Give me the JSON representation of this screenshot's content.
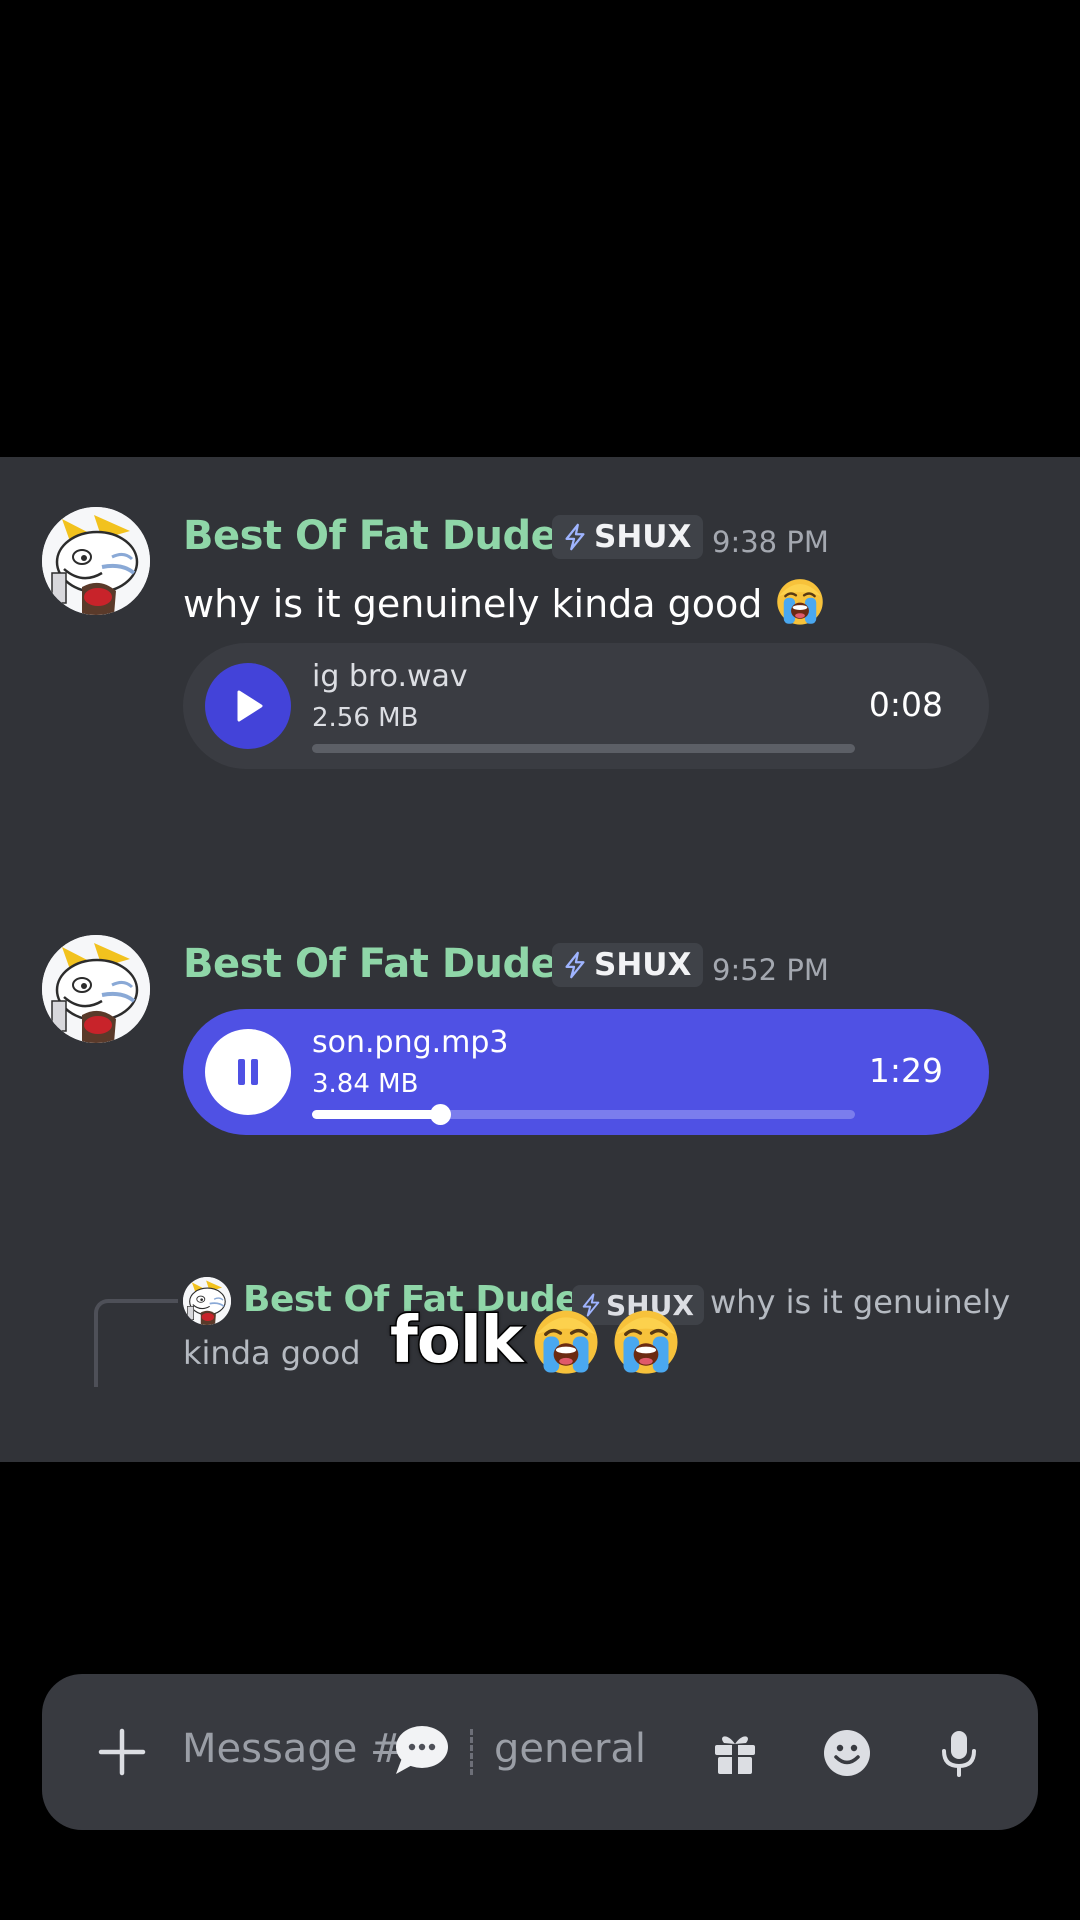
{
  "messages": [
    {
      "username": "Best Of Fat Dudes",
      "tag": "SHUX",
      "time": "9:38 PM",
      "text": "why is it genuinely kinda good",
      "emoji": "loudly-crying-emoji",
      "attachment": {
        "filename": "ig bro.wav",
        "size": "2.56 MB",
        "duration": "0:08",
        "state": "paused",
        "progress": 0
      }
    },
    {
      "reply": {
        "username": "Best Of Fat Dudes",
        "tag": "SHUX",
        "text_line1": "why is it genuinely",
        "text_line2": "kinda good"
      },
      "username": "Best Of Fat Dudes",
      "tag": "SHUX",
      "time": "9:52 PM",
      "attachment": {
        "filename": "son.png.mp3",
        "size": "3.84 MB",
        "duration": "1:29",
        "state": "playing",
        "progress": 0.235
      }
    }
  ],
  "caption": {
    "word": "folk",
    "emojis": [
      "loudly-crying-emoji",
      "loudly-crying-emoji"
    ]
  },
  "composer": {
    "placeholder_prefix": "Message #",
    "channel": "general",
    "icons": [
      "plus-icon",
      "speech-bubble-icon",
      "gift-icon",
      "emoji-icon",
      "microphone-icon"
    ]
  },
  "colors": {
    "background": "#313338",
    "username": "#8fd6a8",
    "blurple": "#4f51e4",
    "letterbox": "#000000"
  }
}
